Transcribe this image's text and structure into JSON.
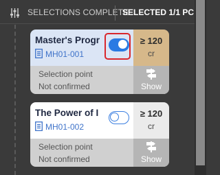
{
  "header": {
    "filter_icon": "sliders-icon",
    "selections_label": "SELECTIONS COMPLETE",
    "selected_label": "SELECTED 1/1 PC"
  },
  "courses": [
    {
      "title": "Master's Progr",
      "code": "MH01-001",
      "toggle_on": true,
      "credits": "≥ 120",
      "credits_unit": "cr",
      "selection_label": "Selection point",
      "selection_status": "Not confirmed",
      "show_label": "Show",
      "colors": {
        "info_bg": "#dbe5f5",
        "credit_bg": "#d6b88a"
      }
    },
    {
      "title": "The Power of I",
      "code": "MH01-002",
      "toggle_on": false,
      "credits": "≥ 120",
      "credits_unit": "cr",
      "selection_label": "Selection point",
      "selection_status": "Not confirmed",
      "show_label": "Show",
      "colors": {
        "info_bg": "#ffffff",
        "credit_bg": "#ebebeb"
      }
    }
  ],
  "colors": {
    "background": "#3a3a3a",
    "toggle_on": "#2a7ae3",
    "highlight": "#d9262c",
    "link": "#3f73c9"
  }
}
